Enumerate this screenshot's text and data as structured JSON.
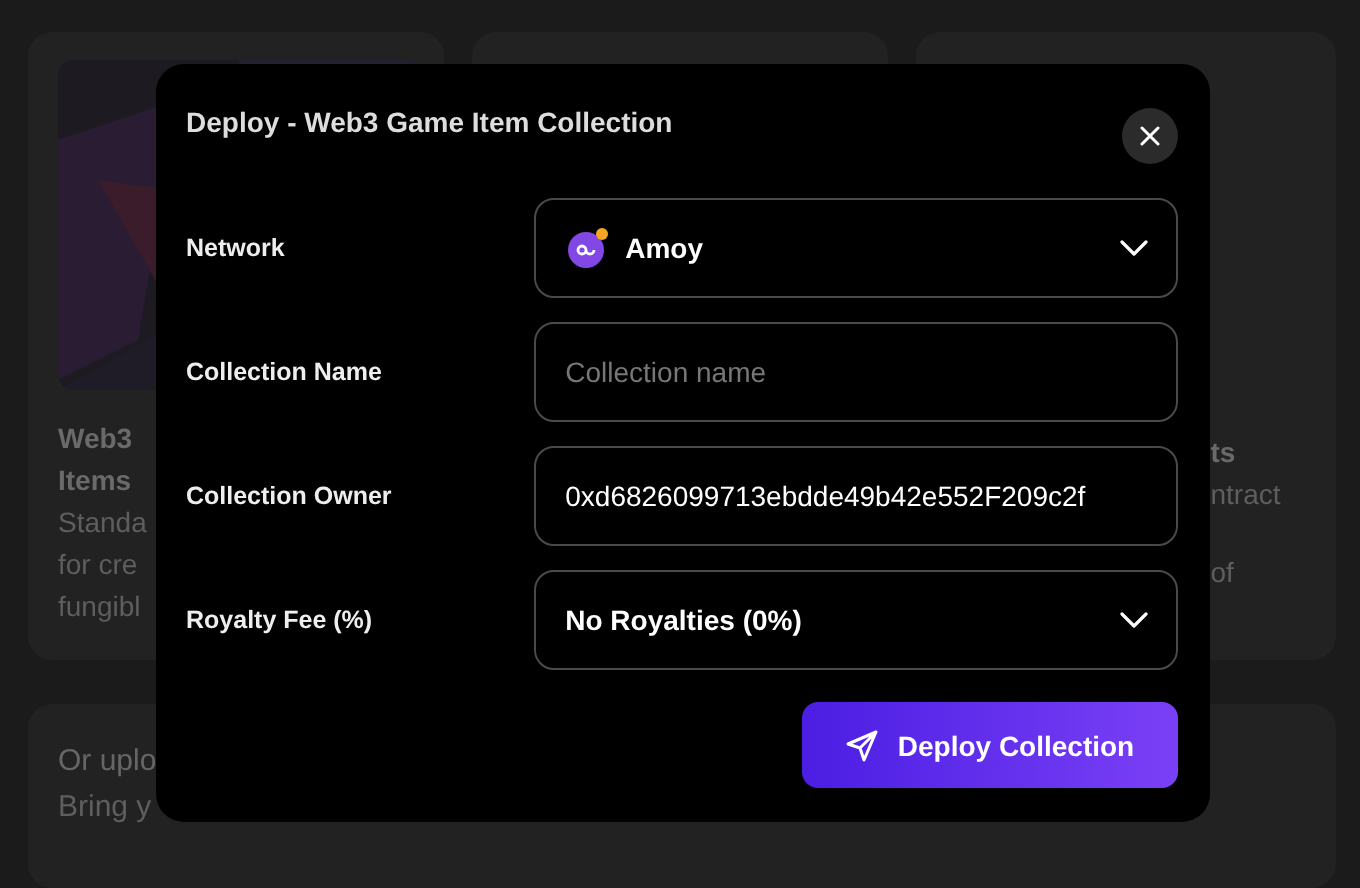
{
  "background": {
    "left_card": {
      "picture": {
        "kind": "picture"
      },
      "title_lines": [
        "Web3",
        "Items"
      ],
      "description_lines": [
        "Standa",
        "for cre",
        "fungibl"
      ]
    },
    "right_card": {
      "title_lines": [
        "ts"
      ],
      "description_lines": [
        "ntract",
        "of"
      ]
    },
    "upload_card": {
      "title": "Or uplo",
      "description": "Bring y"
    }
  },
  "dialog": {
    "title": "Deploy - Web3 Game Item Collection",
    "fields": [
      {
        "kind": "network",
        "label": "Network",
        "value": "Amoy"
      },
      {
        "kind": "text",
        "label": "Collection Name",
        "placeholder": "Collection name"
      },
      {
        "kind": "text",
        "label": "Collection Owner",
        "value": "0xd6826099713ebdde49b42e552F209c2f"
      },
      {
        "kind": "select",
        "label": "Royalty Fee (%)",
        "value": "No Royalties (0%)"
      }
    ],
    "deploy_button": {
      "label": "Deploy Collection"
    }
  }
}
